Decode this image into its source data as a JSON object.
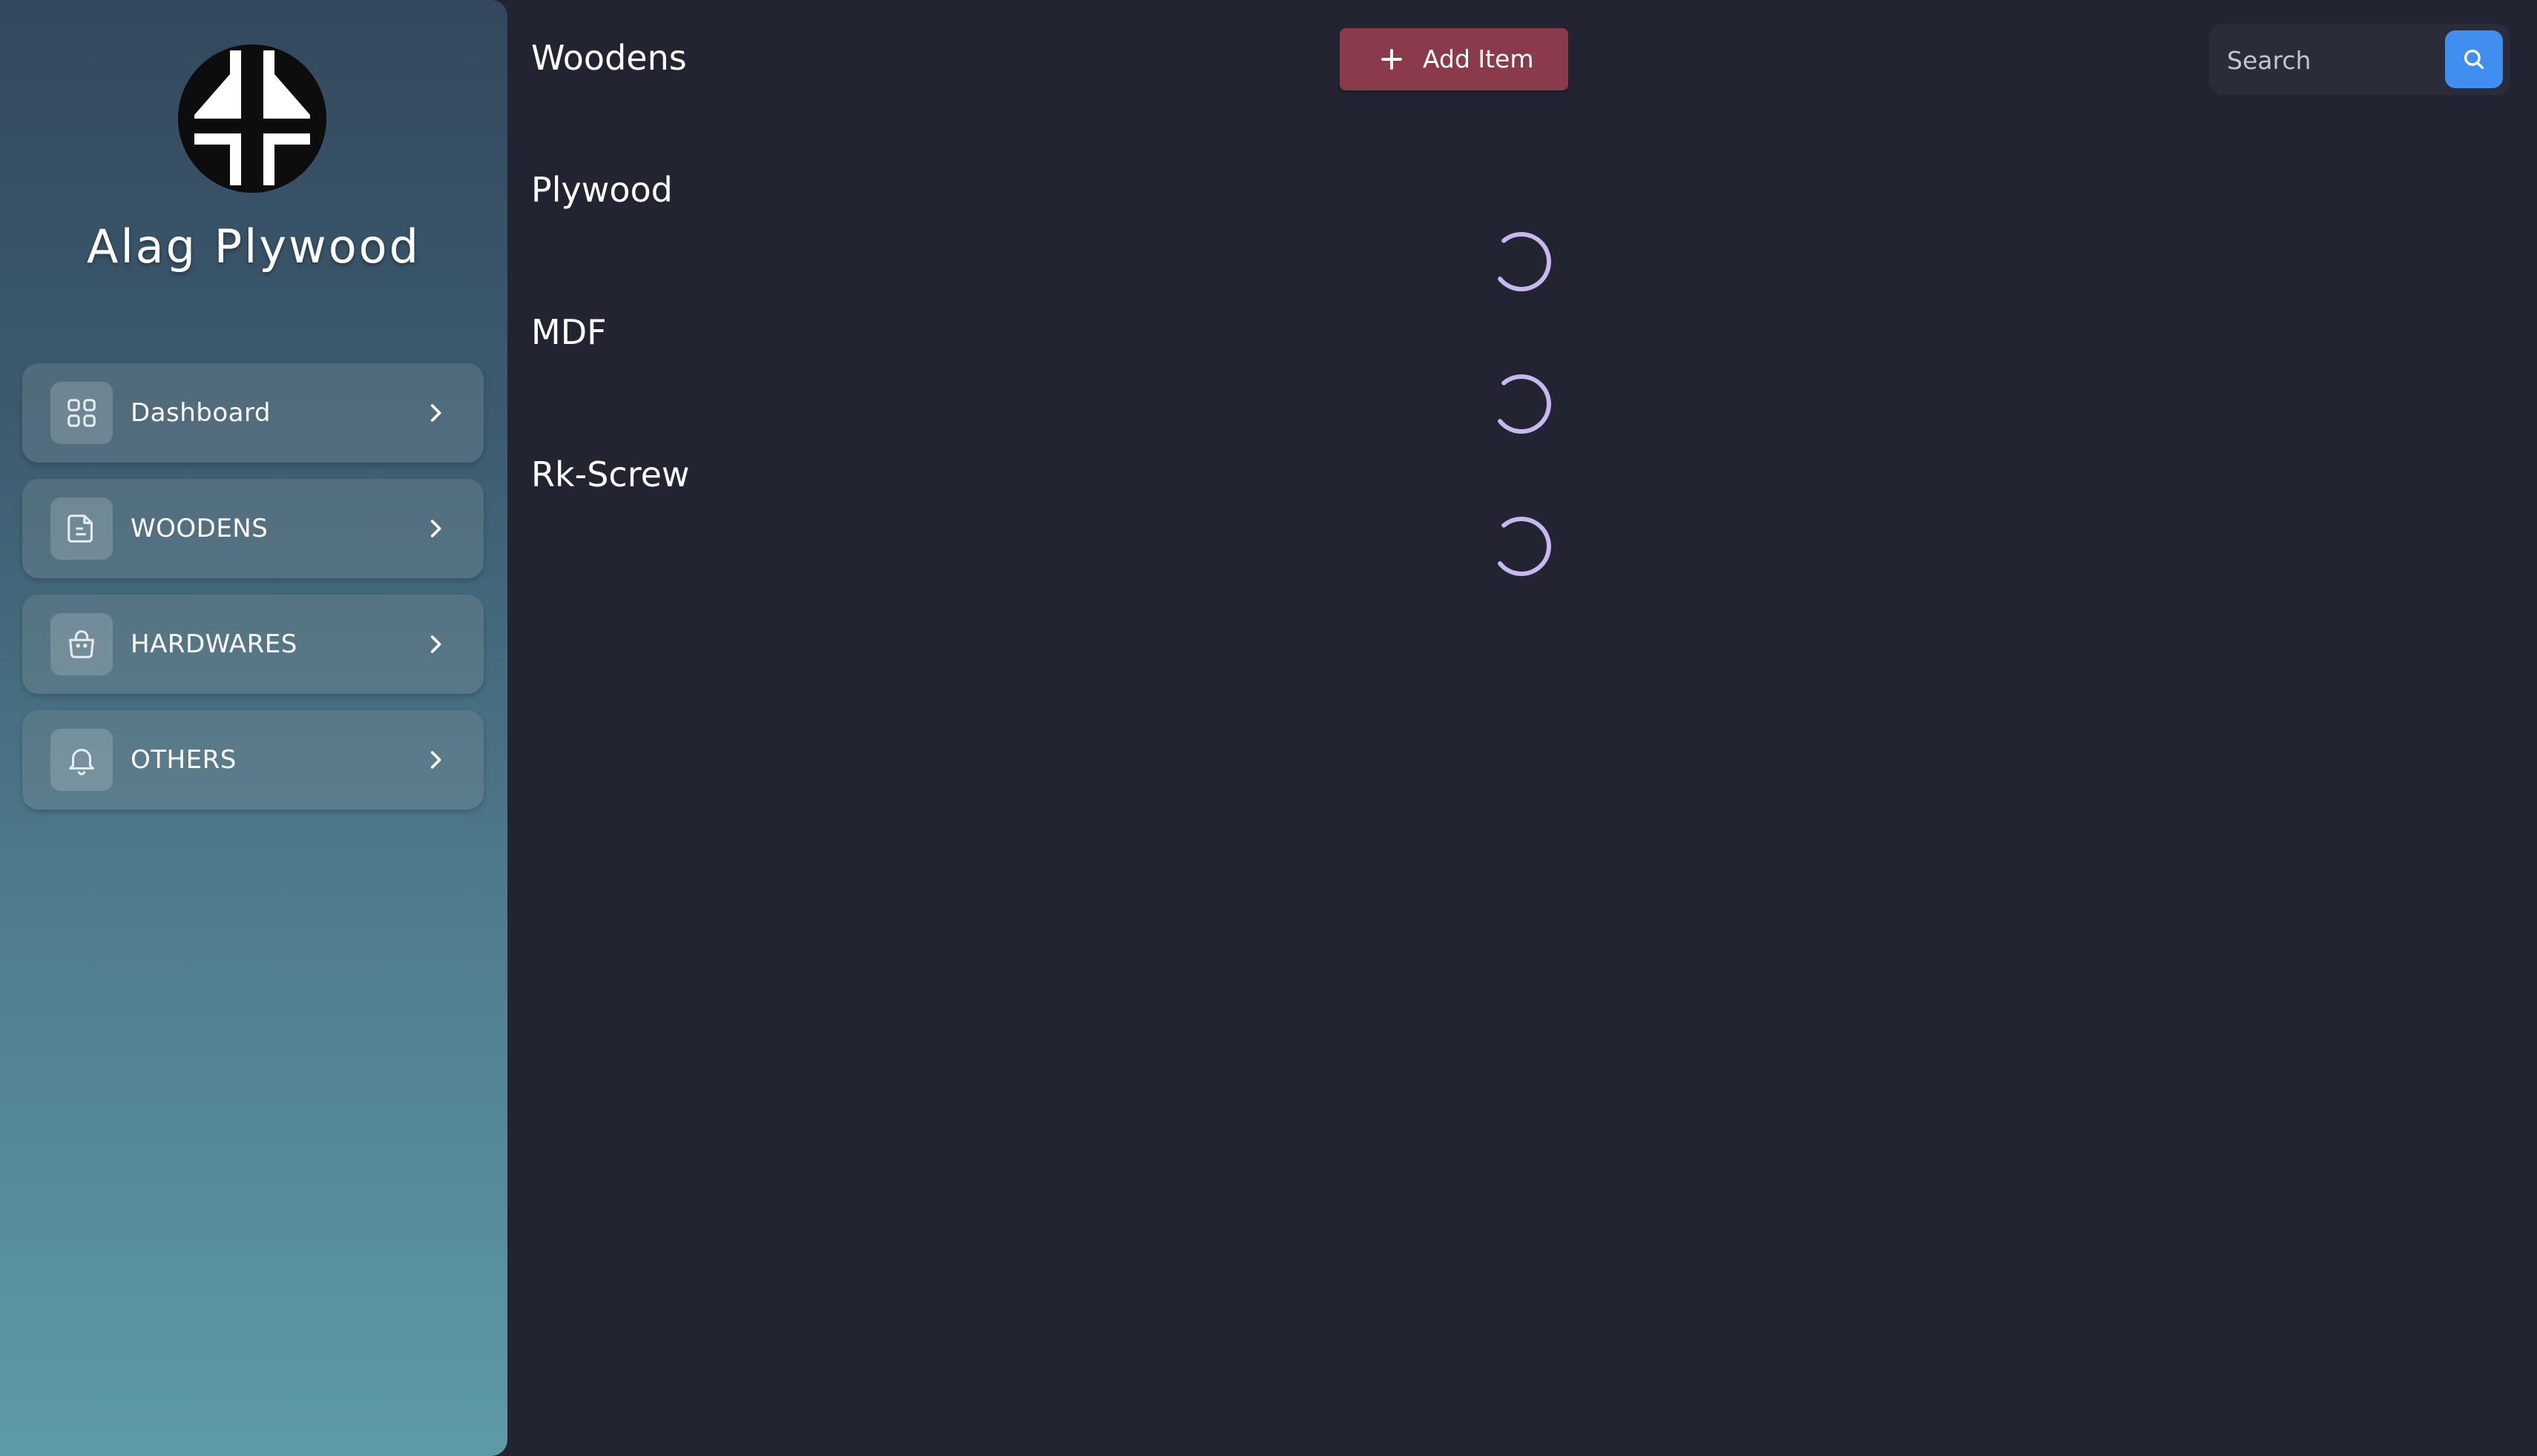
{
  "sidebar": {
    "brand": "Alag Plywood",
    "items": [
      {
        "label": "Dashboard",
        "icon": "dashboard-grid-icon"
      },
      {
        "label": "WOODENS",
        "icon": "document-icon"
      },
      {
        "label": "HARDWARES",
        "icon": "shopping-bag-icon"
      },
      {
        "label": "OTHERS",
        "icon": "bell-icon"
      }
    ]
  },
  "header": {
    "title": "Woodens",
    "add_button_label": "Add Item",
    "search_placeholder": "Search"
  },
  "sections": [
    {
      "title": "Plywood",
      "status": "loading"
    },
    {
      "title": "MDF",
      "status": "loading"
    },
    {
      "title": "Rk-Screw",
      "status": "loading"
    }
  ],
  "colors": {
    "background": "#222432",
    "add_button": "#8b3a4b",
    "search_button": "#3f8ef0",
    "spinner": "#c9b8f0"
  }
}
